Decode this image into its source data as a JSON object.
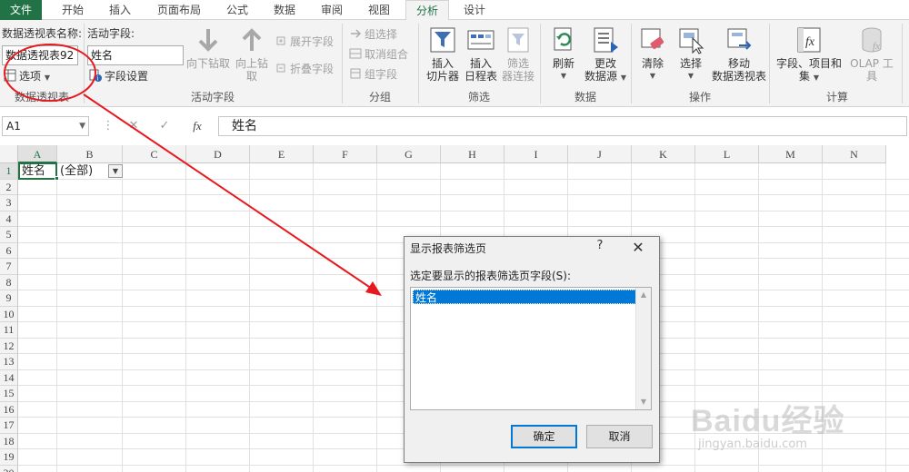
{
  "tabs": [
    {
      "label": "文件",
      "type": "file"
    },
    {
      "label": "开始"
    },
    {
      "label": "插入"
    },
    {
      "label": "页面布局"
    },
    {
      "label": "公式"
    },
    {
      "label": "数据"
    },
    {
      "label": "审阅"
    },
    {
      "label": "视图"
    },
    {
      "label": "分析",
      "active": true
    },
    {
      "label": "设计"
    }
  ],
  "ribbon": {
    "pivot": {
      "name_label": "数据透视表名称:",
      "name_value": "数据透视表92",
      "options_label": "选项",
      "group_label": "数据透视表"
    },
    "active_field": {
      "label": "活动字段:",
      "value": "姓名",
      "field_settings": "字段设置",
      "drill_down": "向下钻取",
      "drill_up_1": "向上钻",
      "drill_up_2": "取",
      "expand": "展开字段",
      "collapse": "折叠字段",
      "group_label": "活动字段"
    },
    "grouping": {
      "group_selection": "组选择",
      "ungroup": "取消组合",
      "group_field": "组字段",
      "group_label": "分组"
    },
    "filter": {
      "slicer_1": "插入",
      "slicer_2": "切片器",
      "timeline_1": "插入",
      "timeline_2": "日程表",
      "connections_1": "筛选",
      "connections_2": "器连接",
      "group_label": "筛选"
    },
    "data": {
      "refresh": "刷新",
      "change_source_1": "更改",
      "change_source_2": "数据源",
      "group_label": "数据"
    },
    "actions": {
      "clear": "清除",
      "select": "选择",
      "move_1": "移动",
      "move_2": "数据透视表",
      "group_label": "操作"
    },
    "calculations": {
      "fields_1": "字段、项目和",
      "fields_2": "集",
      "olap": "OLAP 工具",
      "group_label": "计算"
    }
  },
  "formula_bar": {
    "name_box": "A1",
    "fx": "fx",
    "content": "姓名"
  },
  "grid": {
    "columns": [
      "A",
      "B",
      "C",
      "D",
      "E",
      "F",
      "G",
      "H",
      "I",
      "J",
      "K",
      "L",
      "M",
      "N"
    ],
    "rows": [
      "1",
      "2",
      "3",
      "4",
      "5",
      "6",
      "7",
      "8",
      "9",
      "10",
      "11",
      "12",
      "13",
      "14",
      "15",
      "16",
      "17",
      "18",
      "19",
      "20"
    ],
    "a1": "姓名",
    "b1": "(全部)"
  },
  "dialog": {
    "title": "显示报表筛选页",
    "help": "?",
    "close": "✕",
    "prompt": "选定要显示的报表筛选页字段(S):",
    "items": [
      "姓名"
    ],
    "ok": "确定",
    "cancel": "取消"
  },
  "watermark": {
    "main": "Baidu经验",
    "sub": "jingyan.baidu.com"
  },
  "colors": {
    "excel_green": "#217346",
    "annotation_red": "#e8191e",
    "selection_blue": "#0078d7"
  }
}
